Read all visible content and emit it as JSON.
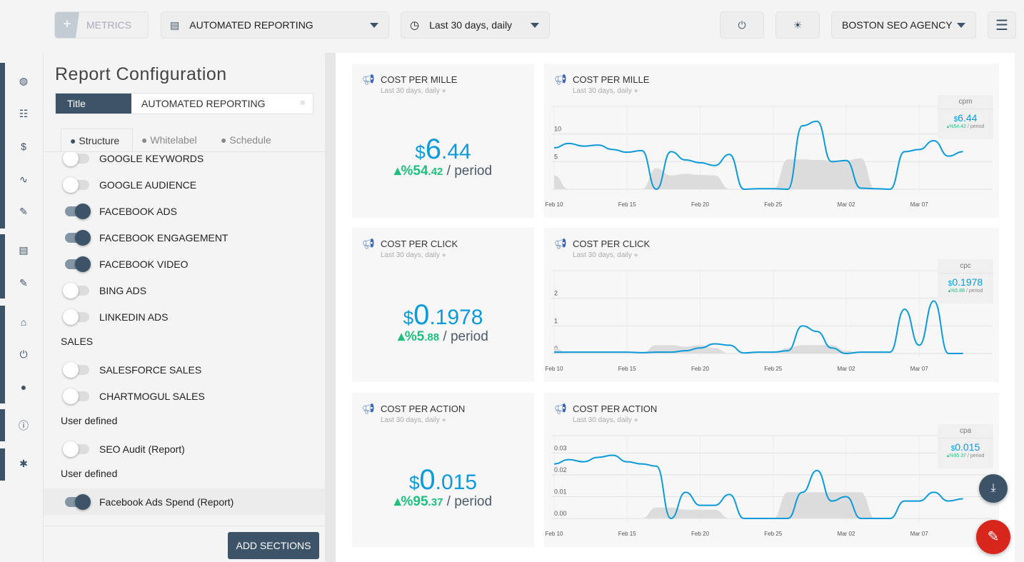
{
  "topbar": {
    "metrics_label": "METRICS",
    "report_select": "AUTOMATED REPORTING",
    "date_select": "Last 30 days, daily",
    "agency_select": "BOSTON SEO AGENCY"
  },
  "sidebar_icons": [
    "globe-icon",
    "users-icon",
    "dollar-cycle-icon",
    "chart-line-icon",
    "brush-icon",
    "clipboard-icon",
    "pencil-icon",
    "bank-icon",
    "plug-icon",
    "account-icon",
    "info-icon",
    "bug-icon"
  ],
  "panel": {
    "heading": "Report Configuration",
    "title_label": "Title",
    "title_value": "AUTOMATED REPORTING",
    "tabs": [
      {
        "label": "Structure",
        "active": true
      },
      {
        "label": "Whitelabel"
      },
      {
        "label": "Schedule"
      }
    ],
    "items": [
      {
        "type": "toggle",
        "label": "GOOGLE KEYWORDS",
        "on": false
      },
      {
        "type": "toggle",
        "label": "GOOGLE AUDIENCE",
        "on": false
      },
      {
        "type": "toggle",
        "label": "FACEBOOK ADS",
        "on": true
      },
      {
        "type": "toggle",
        "label": "FACEBOOK ENGAGEMENT",
        "on": true
      },
      {
        "type": "toggle",
        "label": "FACEBOOK VIDEO",
        "on": true
      },
      {
        "type": "toggle",
        "label": "BING ADS",
        "on": false
      },
      {
        "type": "toggle",
        "label": "LINKEDIN ADS",
        "on": false
      },
      {
        "type": "section",
        "label": "SALES"
      },
      {
        "type": "toggle",
        "label": "SALESFORCE SALES",
        "on": false
      },
      {
        "type": "toggle",
        "label": "CHARTMOGUL SALES",
        "on": false
      },
      {
        "type": "section",
        "label": "User defined"
      },
      {
        "type": "toggle",
        "label": "SEO Audit (Report)",
        "on": false
      },
      {
        "type": "section",
        "label": "User defined"
      },
      {
        "type": "toggle",
        "label": "Facebook Ads Spend (Report)",
        "on": true
      }
    ],
    "add_sections": "ADD SECTIONS"
  },
  "colors": {
    "accent": "#0d9ad8",
    "positive": "#1fbf80",
    "dark": "#3c5368",
    "fab": "#d9261c"
  },
  "widgets": [
    {
      "title": "COST PER MILLE",
      "subtitle": "Last 30 days, daily",
      "currency": "$",
      "int": "6",
      "frac": ".44",
      "change_pct": "54",
      "change_frac": ".42",
      "period": "/ period",
      "legend": "cpm",
      "legend_value": "6.44"
    },
    {
      "title": "COST PER CLICK",
      "subtitle": "Last 30 days, daily",
      "currency": "$",
      "int": "0",
      "frac": ".1978",
      "change_pct": "5",
      "change_frac": ".88",
      "period": "/ period",
      "legend": "cpc",
      "legend_value": "0.1978"
    },
    {
      "title": "COST PER ACTION",
      "subtitle": "Last 30 days, daily",
      "currency": "$",
      "int": "0",
      "frac": ".015",
      "change_pct": "95",
      "change_frac": ".37",
      "period": "/ period",
      "legend": "cpa",
      "legend_value": "0.015"
    }
  ],
  "chart_data": [
    {
      "type": "line",
      "title": "COST PER MILLE",
      "x_ticks": [
        "Feb 10",
        "Feb 15",
        "Feb 20",
        "Feb 25",
        "Mar 02",
        "Mar 07"
      ],
      "y_ticks": [
        "0",
        "5",
        "10"
      ],
      "ylim": [
        0,
        15
      ],
      "days": 29,
      "series": [
        {
          "name": "cpm",
          "values": [
            7.5,
            8.3,
            7.8,
            8,
            7.2,
            6.7,
            7,
            0,
            6.8,
            5.3,
            4.8,
            4.3,
            6.3,
            0,
            0.1,
            0.1,
            0,
            11.5,
            12.3,
            5,
            5.2,
            0.2,
            0.1,
            0,
            6.8,
            7.2,
            8.8,
            6,
            6.8
          ]
        },
        {
          "values": [
            2.5,
            0,
            0,
            0,
            0,
            0,
            0,
            3.8,
            2.5,
            2.8,
            2.6,
            2.5,
            0,
            0,
            0,
            0,
            5.4,
            5.4,
            5.3,
            5.2,
            5.2,
            5.6,
            0,
            0,
            0,
            0,
            0,
            0,
            0
          ]
        }
      ]
    },
    {
      "type": "line",
      "title": "COST PER CLICK",
      "x_ticks": [
        "Feb 10",
        "Feb 15",
        "Feb 20",
        "Feb 25",
        "Mar 02",
        "Mar 07"
      ],
      "y_ticks": [
        "0",
        "1",
        "2"
      ],
      "ylim": [
        0,
        3
      ],
      "days": 29,
      "series": [
        {
          "name": "cpc",
          "values": [
            0.05,
            0.05,
            0.05,
            0.05,
            0.05,
            0.05,
            0.03,
            0.05,
            0.05,
            0.1,
            0.2,
            0.35,
            0.3,
            0.02,
            0.05,
            0.05,
            0.1,
            1.0,
            0.8,
            0.2,
            0,
            0.05,
            0.05,
            0.05,
            1.6,
            0.3,
            1.9,
            0,
            0
          ]
        },
        {
          "values": [
            0.2,
            0,
            0,
            0,
            0,
            0,
            0,
            0.3,
            0.3,
            0.25,
            0.3,
            0.2,
            0,
            0,
            0,
            0,
            0.2,
            0.3,
            0.3,
            0.3,
            0.1,
            0,
            0,
            0,
            0,
            0,
            0,
            0,
            0
          ]
        }
      ]
    },
    {
      "type": "line",
      "title": "COST PER ACTION",
      "x_ticks": [
        "Feb 10",
        "Feb 15",
        "Feb 20",
        "Feb 25",
        "Mar 02",
        "Mar 07"
      ],
      "y_ticks": [
        "0.00",
        "0.01",
        "0.02",
        "0.03"
      ],
      "ylim": [
        0,
        0.038
      ],
      "days": 29,
      "series": [
        {
          "name": "cpa",
          "values": [
            0.025,
            0.027,
            0.026,
            0.028,
            0.029,
            0.026,
            0.025,
            0.024,
            0,
            0.012,
            0.006,
            0.006,
            0.011,
            0,
            0,
            0,
            0,
            0.012,
            0.022,
            0.008,
            0.01,
            0,
            0,
            0,
            0.008,
            0.008,
            0.012,
            0.008,
            0.009
          ]
        },
        {
          "values": [
            0,
            0,
            0,
            0,
            0,
            0,
            0,
            0.005,
            0.005,
            0.004,
            0.004,
            0.004,
            0,
            0,
            0,
            0,
            0.012,
            0.012,
            0.012,
            0.012,
            0.012,
            0.012,
            0,
            0,
            0,
            0,
            0,
            0,
            0
          ]
        }
      ]
    }
  ]
}
